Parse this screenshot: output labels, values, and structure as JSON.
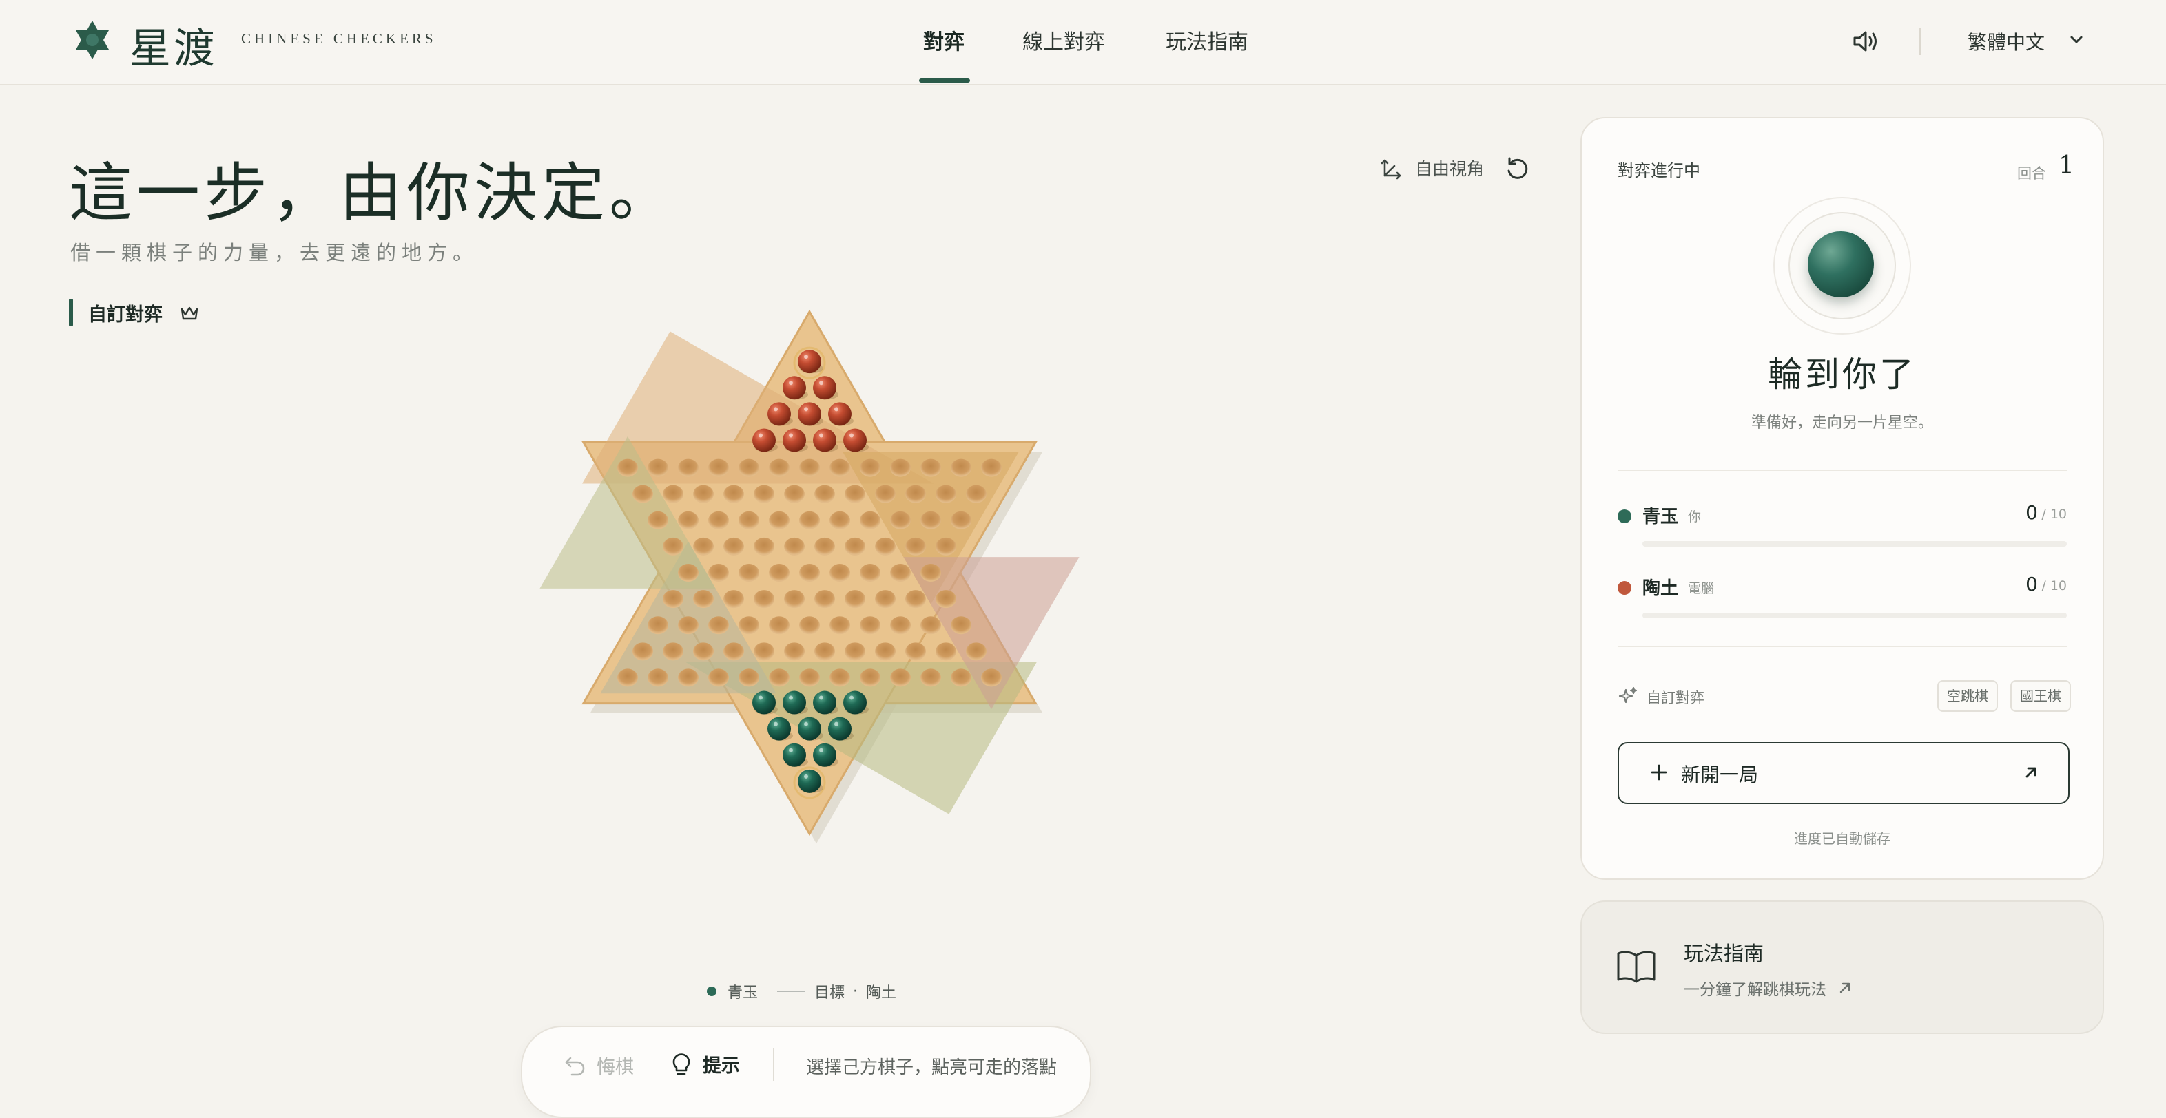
{
  "brand": {
    "name_cn": "星渡",
    "name_en": "CHINESE CHECKERS",
    "logo_icon": "hexagram-star-icon"
  },
  "nav": {
    "items": [
      {
        "label": "對弈",
        "active": true
      },
      {
        "label": "線上對弈",
        "active": false
      },
      {
        "label": "玩法指南",
        "active": false
      }
    ]
  },
  "header_right": {
    "sound_icon": "speaker-icon",
    "language": "繁體中文"
  },
  "hero": {
    "title": "這一步，由你決定。",
    "subtitle": "借一顆棋子的力量，去更遠的地方。",
    "mode_label": "自訂對弈"
  },
  "view_controls": {
    "free_view": "自由視角"
  },
  "board": {
    "type": "chinese-checkers-star",
    "zone_colors": {
      "top": "#dfae78",
      "top_right": "#d6a860",
      "bottom_right": "#cc9f93",
      "bottom": "#b6b982",
      "bottom_left": "#b6b79c",
      "top_left": "#bcbd8a"
    },
    "red_pieces_home": "top",
    "green_pieces_home": "bottom",
    "highlighted_pieces": [
      "top-apex",
      "bottom-apex"
    ]
  },
  "legend": {
    "own": "青玉",
    "target": "目標",
    "separator": "·",
    "opponent": "陶土"
  },
  "controls": {
    "undo": "悔棋",
    "hint": "提示",
    "status": "選擇己方棋子，點亮可走的落點"
  },
  "panel": {
    "status": "對弈進行中",
    "round_label": "回合",
    "round": "1",
    "turn_title": "輪到你了",
    "turn_subtitle": "準備好，走向另一片星空。",
    "players": [
      {
        "name": "青玉",
        "role": "你",
        "score": "0",
        "total": "/ 10",
        "color": "#2e6b58"
      },
      {
        "name": "陶土",
        "role": "電腦",
        "score": "0",
        "total": "/ 10",
        "color": "#c0583c"
      }
    ],
    "mode_label": "自訂對弈",
    "mode_chips": [
      "空跳棋",
      "國王棋"
    ],
    "new_game": "新開一局",
    "autosave": "進度已自動儲存"
  },
  "guide": {
    "title": "玩法指南",
    "subtitle": "一分鐘了解跳棋玩法"
  }
}
